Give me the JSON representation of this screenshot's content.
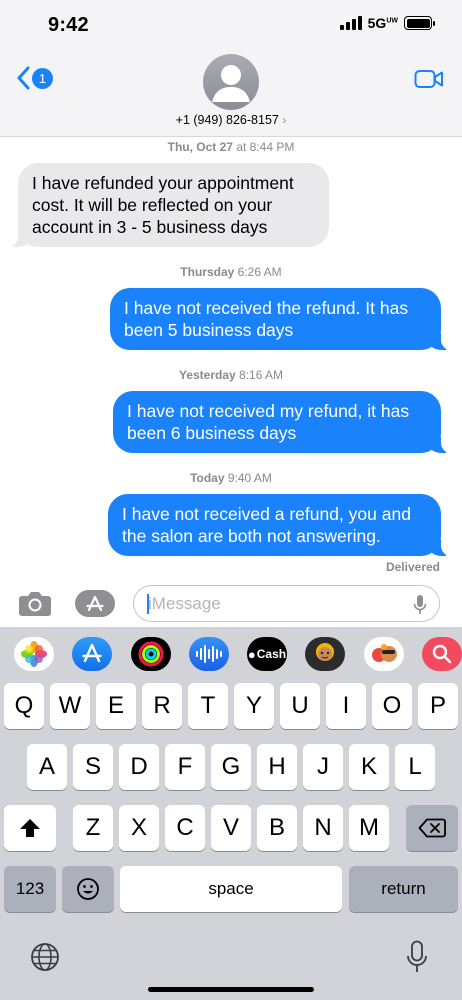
{
  "status_bar": {
    "time": "9:42",
    "network": "5G",
    "network_suffix": "UW"
  },
  "header": {
    "back_badge": "1",
    "contact": "+1 (949) 826-8157",
    "contact_chevron": "›"
  },
  "timestamps": [
    {
      "day": "Thu, Oct 27",
      "time": " at 8:44 PM"
    },
    {
      "day": "Thursday",
      "time": " 6:26 AM"
    },
    {
      "day": "Yesterday",
      "time": " 8:16 AM"
    },
    {
      "day": "Today",
      "time": " 9:40 AM"
    }
  ],
  "messages": [
    {
      "direction": "incoming",
      "text": "I have refunded your appointment cost. It will be reflected on your account in 3 - 5 business days"
    },
    {
      "direction": "outgoing",
      "text": "I have not received the refund. It has been 5 business days"
    },
    {
      "direction": "outgoing",
      "text": "I have not received my refund, it has been 6 business days"
    },
    {
      "direction": "outgoing",
      "text": "I have not received a refund, you and the salon are both not answering."
    }
  ],
  "delivery_status": "Delivered",
  "composer": {
    "placeholder": "iMessage",
    "value": ""
  },
  "app_strip": [
    {
      "name": "photos-icon"
    },
    {
      "name": "app-store-icon"
    },
    {
      "name": "activity-icon"
    },
    {
      "name": "audio-message-icon"
    },
    {
      "name": "apple-cash-icon",
      "label": "Cash"
    },
    {
      "name": "memoji-icon"
    },
    {
      "name": "memoji-stickers-icon"
    },
    {
      "name": "image-search-icon"
    }
  ],
  "keyboard": {
    "row1": [
      "Q",
      "W",
      "E",
      "R",
      "T",
      "Y",
      "U",
      "I",
      "O",
      "P"
    ],
    "row2": [
      "A",
      "S",
      "D",
      "F",
      "G",
      "H",
      "J",
      "K",
      "L"
    ],
    "row3": [
      "Z",
      "X",
      "C",
      "V",
      "B",
      "N",
      "M"
    ],
    "numbers_label": "123",
    "space_label": "space",
    "return_label": "return"
  },
  "colors": {
    "accent": "#1a82fb",
    "incoming_bubble": "#e9e9eb",
    "keyboard_bg": "#d1d3d9"
  }
}
